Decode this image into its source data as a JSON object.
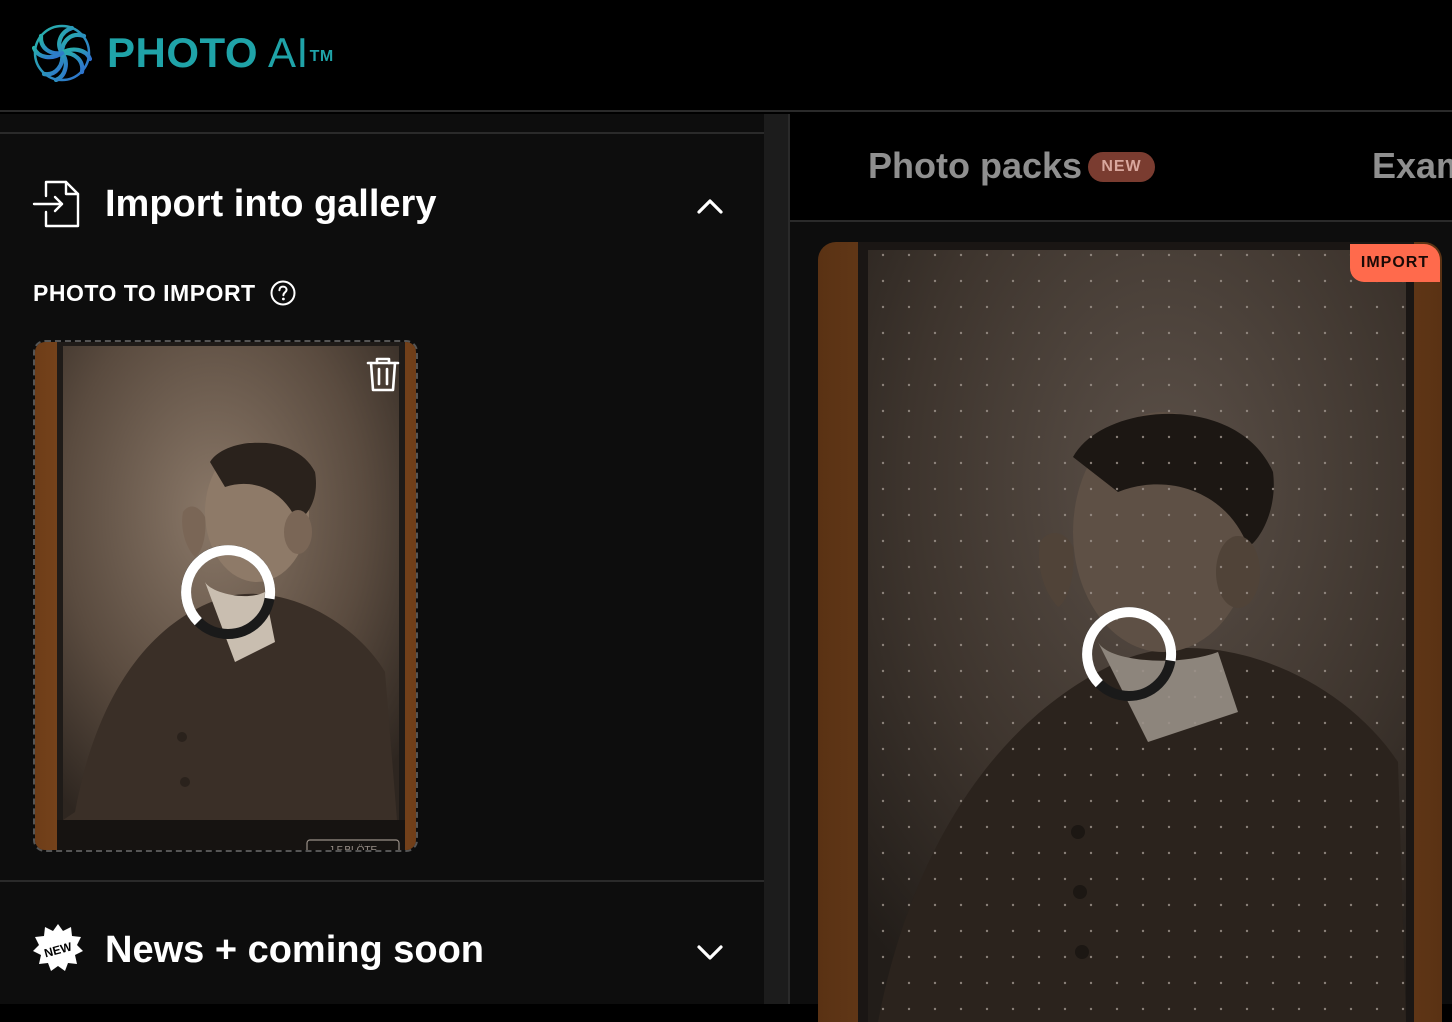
{
  "app": {
    "brand_strong": "PHOTO",
    "brand_light": "AI",
    "brand_tm": "TM",
    "accent_color": "#1fa3a8"
  },
  "left_panel": {
    "import_section": {
      "title": "Import into gallery",
      "icon": "import-file-icon",
      "expanded": true,
      "photo_label": "PHOTO TO IMPORT",
      "help_icon": "question-circle-icon",
      "thumbnail": {
        "loading": true,
        "delete_icon": "trash-icon",
        "card_caption": "J.F.BLÖTE"
      }
    },
    "news_section": {
      "title": "News + coming soon",
      "icon": "new-starburst-icon",
      "badge_text": "NEW",
      "expanded": false
    }
  },
  "right_panel": {
    "tabs": [
      {
        "label": "Photo packs",
        "badge": "NEW",
        "badge_color": "#7a3c30"
      },
      {
        "label": "Examples"
      }
    ],
    "preview": {
      "badge": "IMPORT",
      "badge_color": "#ff6a4c",
      "loading": true
    }
  }
}
